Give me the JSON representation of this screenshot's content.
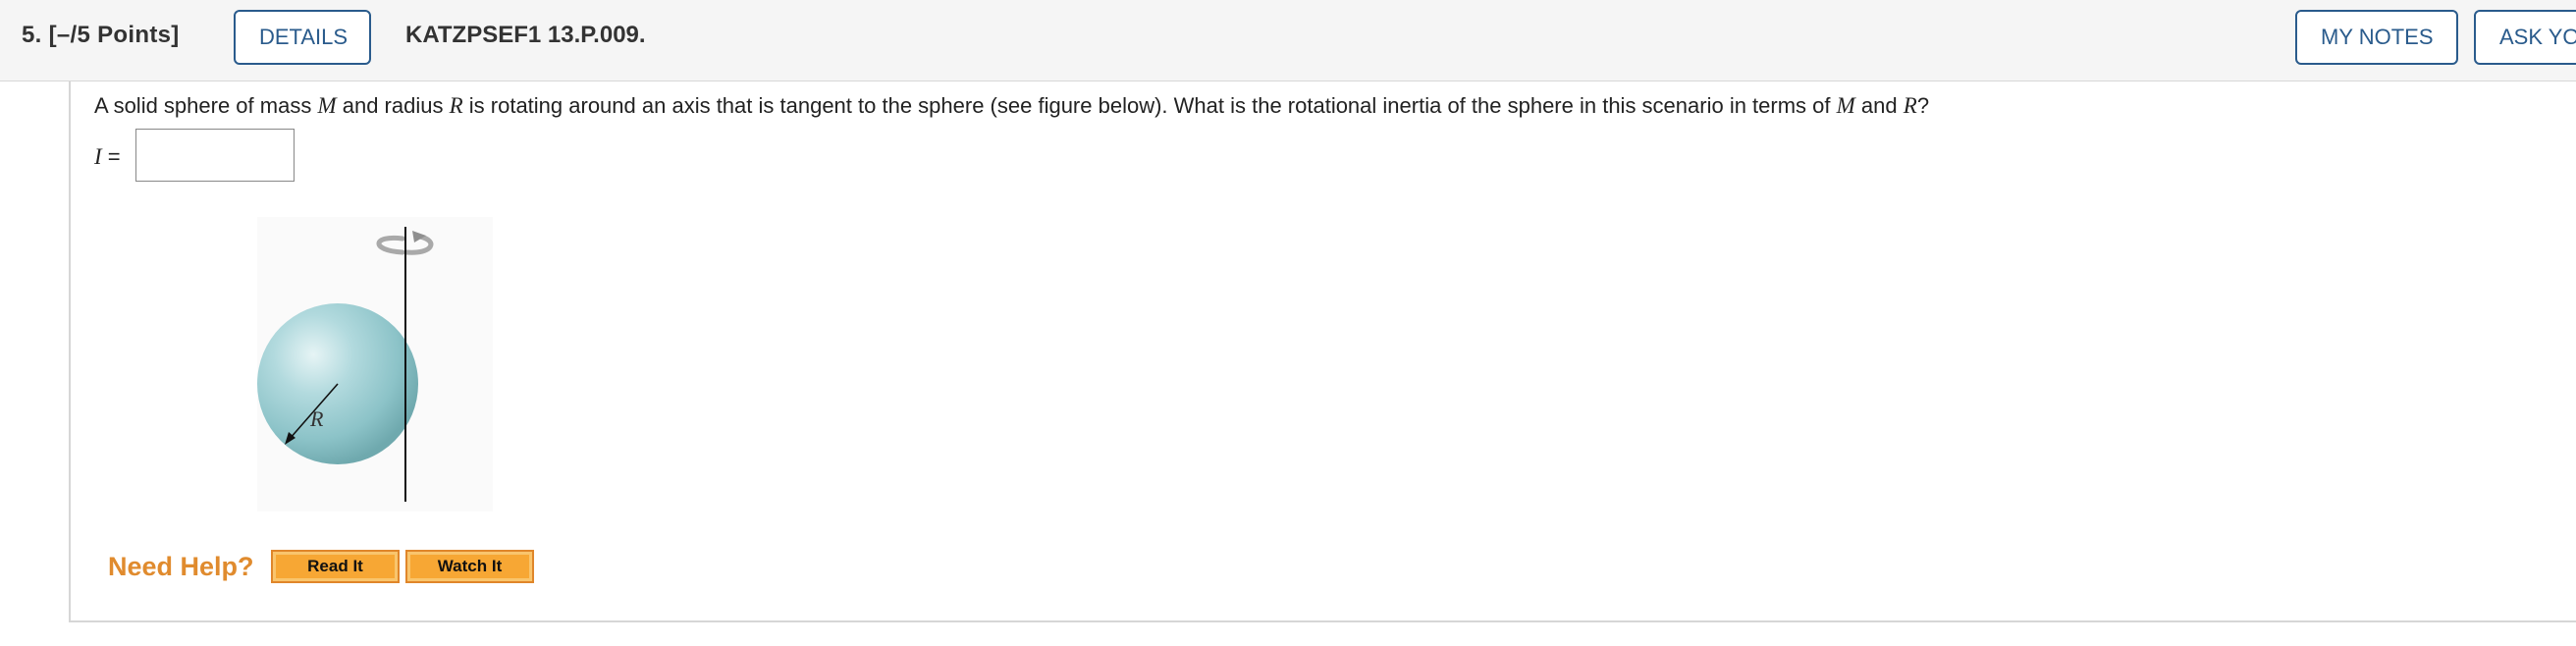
{
  "header": {
    "question_number": "5.",
    "points": "[–/5 Points]",
    "details_label": "DETAILS",
    "problem_code": "KATZPSEF1 13.P.009.",
    "my_notes_label": "MY NOTES",
    "ask_label": "ASK YOUR TEACHER"
  },
  "question": {
    "text_parts": [
      "A solid sphere of mass ",
      "M",
      " and radius ",
      "R",
      " is rotating around an axis that is tangent to the sphere (see figure below). What is the rotational inertia of the sphere in this scenario in terms of ",
      "M",
      " and ",
      "R",
      "?"
    ],
    "answer_var": "I",
    "answer_eq": " =",
    "answer_value": "",
    "answer_placeholder": ""
  },
  "figure": {
    "radius_label": "R",
    "sphere_color": "#8fc4c9",
    "arrow_color": "#a9a9a9"
  },
  "help": {
    "need_help_label": "Need Help?",
    "read_it_label": "Read It",
    "watch_it_label": "Watch It",
    "accent_color": "#e08b2e"
  }
}
